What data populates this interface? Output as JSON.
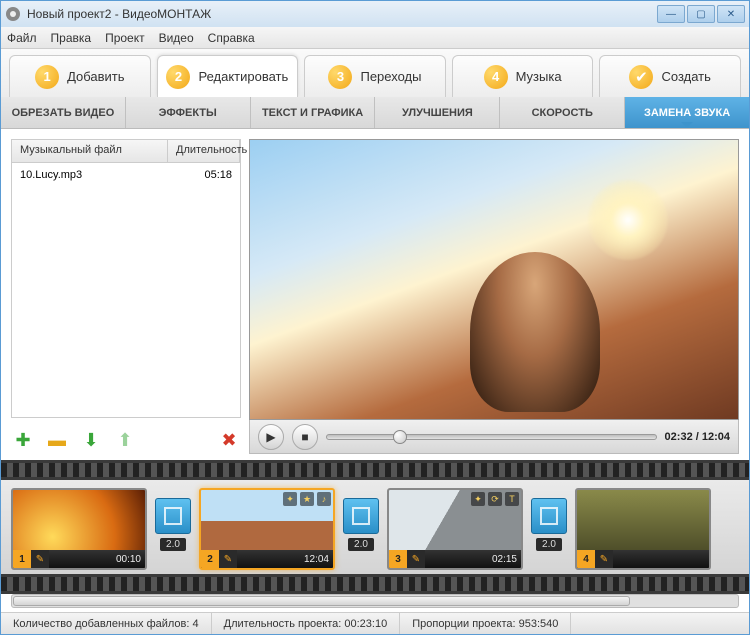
{
  "window": {
    "title": "Новый проект2 - ВидеоМОНТАЖ"
  },
  "menu": {
    "file": "Файл",
    "edit": "Правка",
    "project": "Проект",
    "video": "Видео",
    "help": "Справка"
  },
  "tabs": {
    "add": {
      "num": "1",
      "label": "Добавить"
    },
    "edit": {
      "num": "2",
      "label": "Редактировать"
    },
    "trans": {
      "num": "3",
      "label": "Переходы"
    },
    "music": {
      "num": "4",
      "label": "Музыка"
    },
    "create": {
      "label": "Создать"
    }
  },
  "subtabs": {
    "crop": "ОБРЕЗАТЬ ВИДЕО",
    "effects": "ЭФФЕКТЫ",
    "text": "ТЕКСТ И ГРАФИКА",
    "enhance": "УЛУЧШЕНИЯ",
    "speed": "СКОРОСТЬ",
    "audio": "ЗАМЕНА ЗВУКА"
  },
  "audiolist": {
    "col_file": "Музыкальный файл",
    "col_dur": "Длительность",
    "rows": [
      {
        "file": "10.Lucy.mp3",
        "dur": "05:18"
      }
    ]
  },
  "player": {
    "time_current": "02:32",
    "time_total": "12:04"
  },
  "timeline": {
    "clips": [
      {
        "idx": "1",
        "dur": "00:10"
      },
      {
        "idx": "2",
        "dur": "12:04"
      },
      {
        "idx": "3",
        "dur": "02:15"
      },
      {
        "idx": "4",
        "dur": ""
      }
    ],
    "transitions": [
      {
        "dur": "2.0"
      },
      {
        "dur": "2.0"
      },
      {
        "dur": "2.0"
      }
    ]
  },
  "status": {
    "files_label": "Количество добавленных файлов:",
    "files_val": "4",
    "length_label": "Длительность проекта:",
    "length_val": "00:23:10",
    "ratio_label": "Пропорции проекта:",
    "ratio_val": "953:540"
  }
}
